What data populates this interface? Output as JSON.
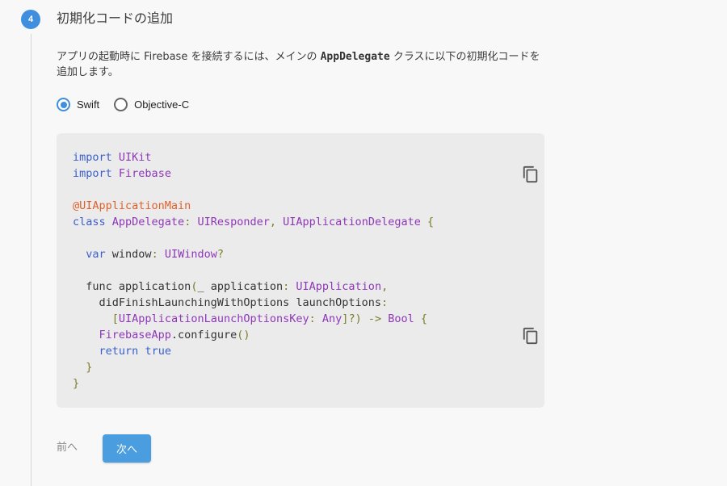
{
  "step": {
    "number": "4",
    "title": "初期化コードの追加",
    "description_before": "アプリの起動時に Firebase を接続するには、メインの ",
    "description_code": "AppDelegate",
    "description_after": " クラスに以下の初期化コードを追加します。"
  },
  "language_selector": {
    "options": [
      "Swift",
      "Objective-C"
    ],
    "selected": "Swift"
  },
  "code_block": {
    "language": "swift",
    "lines": [
      "import UIKit",
      "import Firebase",
      "",
      "@UIApplicationMain",
      "class AppDelegate: UIResponder, UIApplicationDelegate {",
      "",
      "  var window: UIWindow?",
      "",
      "  func application(_ application: UIApplication,",
      "    didFinishLaunchingWithOptions launchOptions:",
      "      [UIApplicationLaunchOptionsKey: Any]?) -> Bool {",
      "    FirebaseApp.configure()",
      "    return true",
      "  }",
      "}"
    ],
    "copy_icons": [
      "copy-icon",
      "copy-icon"
    ]
  },
  "navigation": {
    "prev_label": "前へ",
    "next_label": "次へ"
  },
  "colors": {
    "accent": "#3f8fde",
    "button": "#4a9ee0",
    "keyword": "#3a5fcd",
    "type": "#8e37b8",
    "attribute": "#e0602c",
    "punctuation": "#7c7c2a",
    "code_background": "#ebebeb"
  }
}
